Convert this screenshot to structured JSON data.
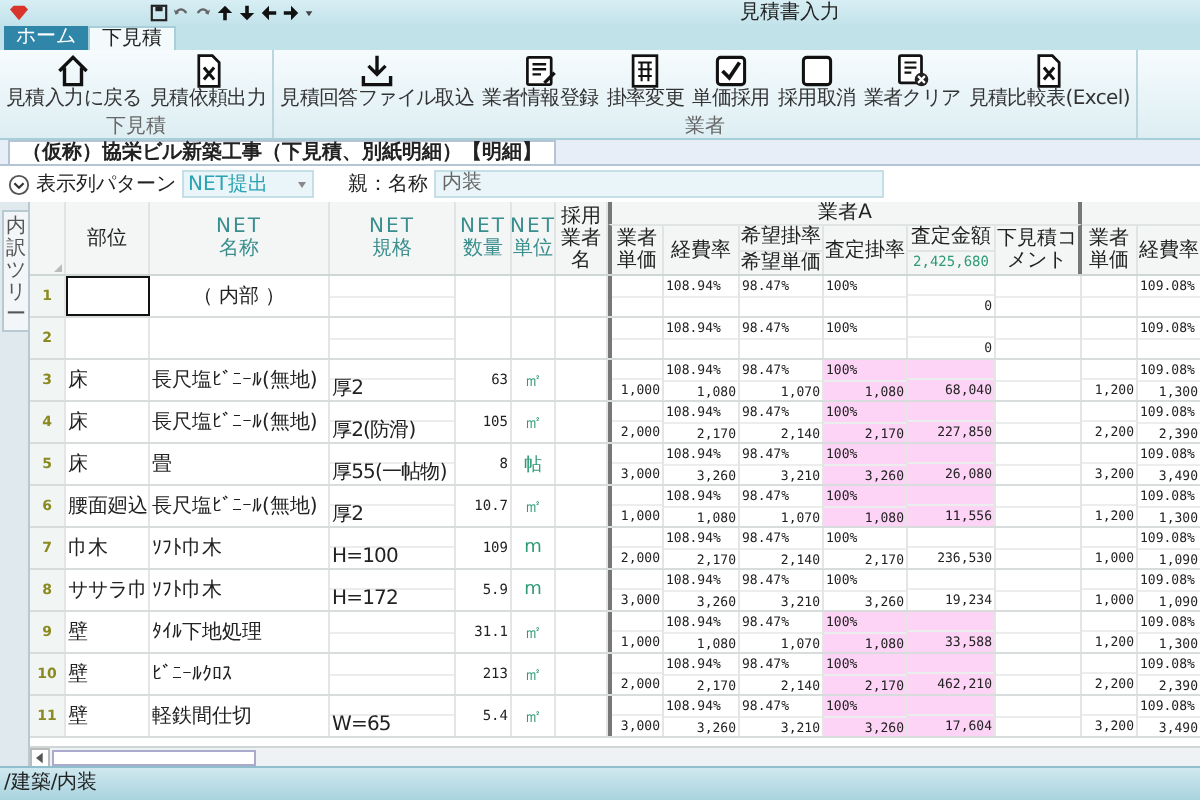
{
  "window": {
    "title": "見積書入力"
  },
  "ribbon_tabs": [
    {
      "label": "ホーム",
      "selected": false
    },
    {
      "label": "下見積",
      "selected": true
    }
  ],
  "ribbon_groups": [
    {
      "label": "下見積",
      "buttons": [
        {
          "label": "見積入力に戻る",
          "kind": "home"
        },
        {
          "label": "見積依頼出力",
          "kind": "excel"
        }
      ]
    },
    {
      "label": "業者",
      "buttons": [
        {
          "label": "見積回答ファイル取込",
          "kind": "download"
        },
        {
          "label": "業者情報登録",
          "kind": "form"
        },
        {
          "label": "掛率変更",
          "kind": "calc"
        },
        {
          "label": "単価採用",
          "kind": "check"
        },
        {
          "label": "採用取消",
          "kind": "box"
        },
        {
          "label": "業者クリア",
          "kind": "clear"
        },
        {
          "label": "見積比較表(Excel)",
          "kind": "excel"
        }
      ]
    }
  ],
  "document_tab": {
    "title": "（仮称）協栄ビル新築工事（下見積、別紙明細）【明細】"
  },
  "filter": {
    "label": "表示列パターン",
    "value": "NET提出",
    "parent_label": "親：名称",
    "parent_value": "内装"
  },
  "side_tab": "内訳ツリー",
  "grid": {
    "fixed_columns": [
      {
        "lines": [
          "部位"
        ]
      },
      {
        "lines": [
          "NET",
          "名称"
        ]
      },
      {
        "lines": [
          "NET",
          "規格"
        ]
      },
      {
        "lines": [
          "NET",
          "数量"
        ]
      },
      {
        "lines": [
          "NET",
          "単位"
        ]
      },
      {
        "lines": [
          "採用業者名"
        ]
      }
    ],
    "group_name": "業者A",
    "group_columns": [
      {
        "label": "業者単価"
      },
      {
        "label": "経費率"
      },
      {
        "label": "希望掛率",
        "sub": "希望単価"
      },
      {
        "label": "査定掛率"
      },
      {
        "label": "査定金額",
        "sub": "2,425,680"
      },
      {
        "label": "下見積コメント"
      }
    ],
    "second_group_columns": [
      {
        "label": "業者単価"
      },
      {
        "label": "経費率"
      }
    ],
    "rows": [
      {
        "num": "1",
        "name": "（ 内部 ）",
        "selected": true,
        "highlight": false,
        "a": {
          "cost_rate": "108.94%",
          "desired_rate": "98.47%",
          "assessed_rate": "100%",
          "amount": "0"
        },
        "b": {
          "cost_rate": "109.08%"
        }
      },
      {
        "num": "2",
        "selected": false,
        "highlight": false,
        "a": {
          "cost_rate": "108.94%",
          "desired_rate": "98.47%",
          "assessed_rate": "100%",
          "amount": "0"
        },
        "b": {
          "cost_rate": "109.08%"
        }
      },
      {
        "num": "3",
        "part": "床",
        "name": "長尺塩ﾋﾞﾆｰﾙ(無地)",
        "spec": "厚2",
        "qty": "63",
        "unit": "㎡",
        "selected": false,
        "highlight": true,
        "a": {
          "cost_rate": "108.94%",
          "desired_rate": "98.47%",
          "assessed_rate": "100%",
          "unit_price": "1,000",
          "cost_price": "1,080",
          "desired_price": "1,070",
          "assessed_price": "1,080",
          "amount": "68,040"
        },
        "b": {
          "cost_rate": "109.08%",
          "unit_price": "1,200",
          "cost_price": "1,300"
        }
      },
      {
        "num": "4",
        "part": "床",
        "name": "長尺塩ﾋﾞﾆｰﾙ(無地)",
        "spec": "厚2(防滑)",
        "qty": "105",
        "unit": "㎡",
        "selected": false,
        "highlight": true,
        "a": {
          "cost_rate": "108.94%",
          "desired_rate": "98.47%",
          "assessed_rate": "100%",
          "unit_price": "2,000",
          "cost_price": "2,170",
          "desired_price": "2,140",
          "assessed_price": "2,170",
          "amount": "227,850"
        },
        "b": {
          "cost_rate": "109.08%",
          "unit_price": "2,200",
          "cost_price": "2,390"
        }
      },
      {
        "num": "5",
        "part": "床",
        "name": "畳",
        "spec": "厚55(一帖物)",
        "qty": "8",
        "unit": "帖",
        "selected": false,
        "highlight": true,
        "a": {
          "cost_rate": "108.94%",
          "desired_rate": "98.47%",
          "assessed_rate": "100%",
          "unit_price": "3,000",
          "cost_price": "3,260",
          "desired_price": "3,210",
          "assessed_price": "3,260",
          "amount": "26,080"
        },
        "b": {
          "cost_rate": "109.08%",
          "unit_price": "3,200",
          "cost_price": "3,490"
        }
      },
      {
        "num": "6",
        "part": "腰面廻込",
        "name": "長尺塩ﾋﾞﾆｰﾙ(無地)",
        "spec": "厚2",
        "qty": "10.7",
        "unit": "㎡",
        "selected": false,
        "highlight": true,
        "a": {
          "cost_rate": "108.94%",
          "desired_rate": "98.47%",
          "assessed_rate": "100%",
          "unit_price": "1,000",
          "cost_price": "1,080",
          "desired_price": "1,070",
          "assessed_price": "1,080",
          "amount": "11,556"
        },
        "b": {
          "cost_rate": "109.08%",
          "unit_price": "1,200",
          "cost_price": "1,300"
        }
      },
      {
        "num": "7",
        "part": "巾木",
        "name": "ｿﾌﾄ巾木",
        "spec": "H=100",
        "qty": "109",
        "unit": "m",
        "selected": false,
        "highlight": false,
        "a": {
          "cost_rate": "108.94%",
          "desired_rate": "98.47%",
          "assessed_rate": "100%",
          "unit_price": "2,000",
          "cost_price": "2,170",
          "desired_price": "2,140",
          "assessed_price": "2,170",
          "amount": "236,530"
        },
        "b": {
          "cost_rate": "109.08%",
          "unit_price": "1,000",
          "cost_price": "1,090"
        }
      },
      {
        "num": "8",
        "part": "ササラ巾",
        "name": "ｿﾌﾄ巾木",
        "spec": "H=172",
        "qty": "5.9",
        "unit": "m",
        "selected": false,
        "highlight": false,
        "a": {
          "cost_rate": "108.94%",
          "desired_rate": "98.47%",
          "assessed_rate": "100%",
          "unit_price": "3,000",
          "cost_price": "3,260",
          "desired_price": "3,210",
          "assessed_price": "3,260",
          "amount": "19,234"
        },
        "b": {
          "cost_rate": "109.08%",
          "unit_price": "1,000",
          "cost_price": "1,090"
        }
      },
      {
        "num": "9",
        "part": "壁",
        "name": "ﾀｲﾙ下地処理",
        "qty": "31.1",
        "unit": "㎡",
        "selected": false,
        "highlight": true,
        "a": {
          "cost_rate": "108.94%",
          "desired_rate": "98.47%",
          "assessed_rate": "100%",
          "unit_price": "1,000",
          "cost_price": "1,080",
          "desired_price": "1,070",
          "assessed_price": "1,080",
          "amount": "33,588"
        },
        "b": {
          "cost_rate": "109.08%",
          "unit_price": "1,200",
          "cost_price": "1,300"
        }
      },
      {
        "num": "10",
        "part": "壁",
        "name": "ﾋﾞﾆｰﾙｸﾛｽ",
        "qty": "213",
        "unit": "㎡",
        "selected": false,
        "highlight": true,
        "a": {
          "cost_rate": "108.94%",
          "desired_rate": "98.47%",
          "assessed_rate": "100%",
          "unit_price": "2,000",
          "cost_price": "2,170",
          "desired_price": "2,140",
          "assessed_price": "2,170",
          "amount": "462,210"
        },
        "b": {
          "cost_rate": "109.08%",
          "unit_price": "2,200",
          "cost_price": "2,390"
        }
      },
      {
        "num": "11",
        "part": "壁",
        "name": "軽鉄間仕切",
        "spec": "W=65",
        "qty": "5.4",
        "unit": "㎡",
        "selected": false,
        "highlight": true,
        "a": {
          "cost_rate": "108.94%",
          "desired_rate": "98.47%",
          "assessed_rate": "100%",
          "unit_price": "3,000",
          "cost_price": "3,260",
          "desired_price": "3,210",
          "assessed_price": "3,260",
          "amount": "17,604"
        },
        "b": {
          "cost_rate": "109.08%",
          "unit_price": "3,200",
          "cost_price": "3,490"
        }
      }
    ]
  },
  "status_bar": "/建築/内装"
}
